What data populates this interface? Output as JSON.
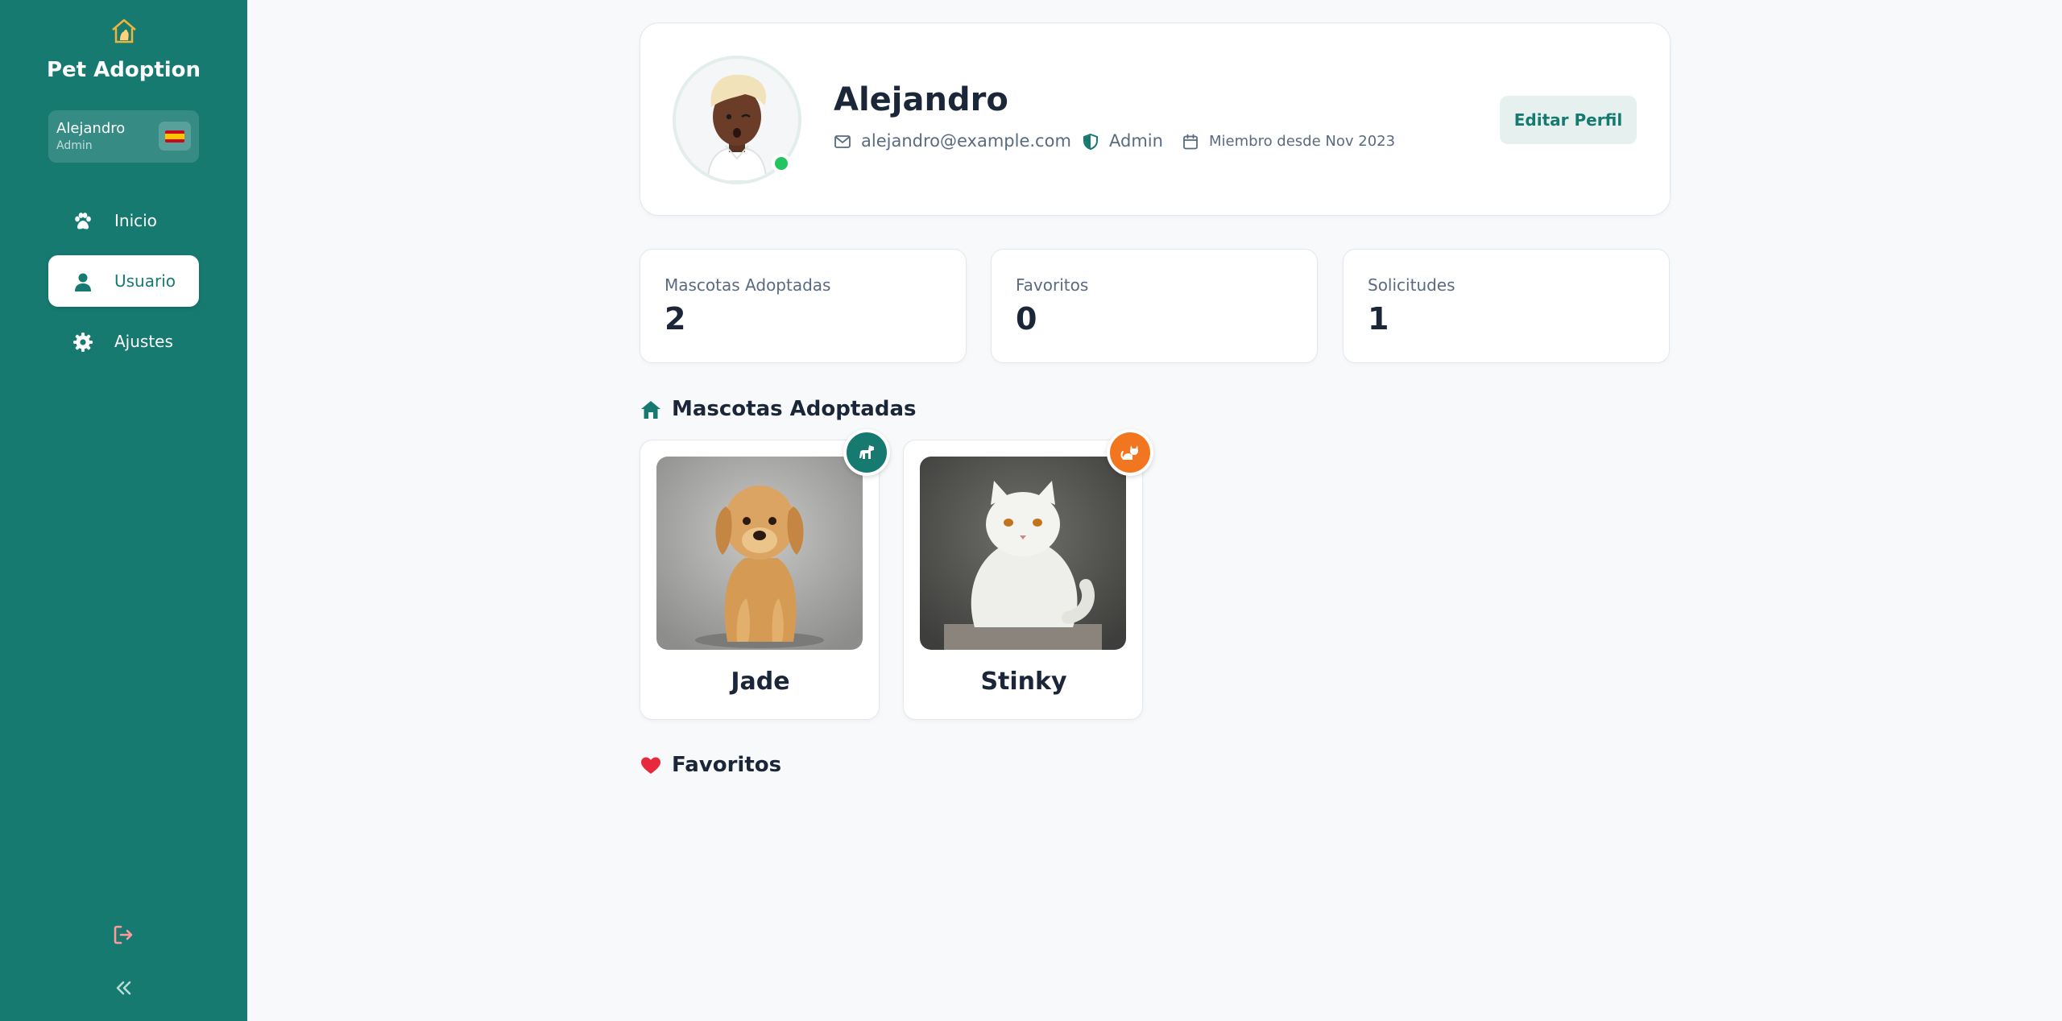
{
  "sidebar": {
    "app_title": "Pet Adoption",
    "user": {
      "name": "Alejandro",
      "role": "Admin"
    },
    "nav": [
      {
        "label": "Inicio",
        "icon": "paw-icon",
        "active": false
      },
      {
        "label": "Usuario",
        "icon": "user-icon",
        "active": true
      },
      {
        "label": "Ajustes",
        "icon": "gear-icon",
        "active": false
      }
    ],
    "footer_icons": [
      "logout-icon",
      "collapse-icon"
    ]
  },
  "profile": {
    "name": "Alejandro",
    "email": "alejandro@example.com",
    "role": "Admin",
    "member_since": "Miembro desde Nov 2023",
    "edit_label": "Editar Perfil",
    "status": "online"
  },
  "stats": [
    {
      "label": "Mascotas Adoptadas",
      "value": "2"
    },
    {
      "label": "Favoritos",
      "value": "0"
    },
    {
      "label": "Solicitudes",
      "value": "1"
    }
  ],
  "sections": {
    "adopted_title": "Mascotas Adoptadas",
    "favorites_title": "Favoritos"
  },
  "adopted_pets": [
    {
      "name": "Jade",
      "species_icon": "dog-icon"
    },
    {
      "name": "Stinky",
      "species_icon": "cat-icon"
    }
  ],
  "colors": {
    "sidebar": "#167a70",
    "accent": "#167a70",
    "online": "#23c55e",
    "cat_badge": "#f2761f",
    "heart": "#e8293b"
  }
}
